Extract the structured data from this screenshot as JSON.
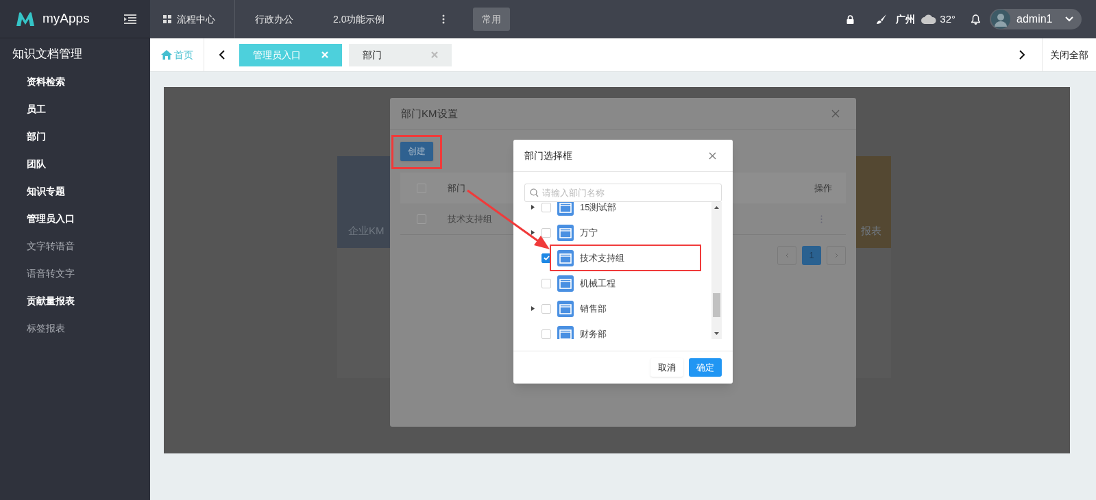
{
  "app": {
    "name": "myApps"
  },
  "top_nav": {
    "items": [
      {
        "label": "流程中心",
        "kind": "grid"
      },
      {
        "label": "行政办公",
        "kind": "plain"
      },
      {
        "label": "2.0功能示例",
        "kind": "plain"
      }
    ],
    "common_button": "常用"
  },
  "status": {
    "city": "广州",
    "temperature": "32°",
    "user": "admin1"
  },
  "sidebar": {
    "title": "知识文档管理",
    "items": [
      {
        "label": "资料检索",
        "highlighted": true
      },
      {
        "label": "员工",
        "highlighted": true
      },
      {
        "label": "部门",
        "highlighted": true
      },
      {
        "label": "团队",
        "highlighted": true
      },
      {
        "label": "知识专题",
        "highlighted": true
      },
      {
        "label": "管理员入口",
        "highlighted": true
      },
      {
        "label": "文字转语音",
        "highlighted": false
      },
      {
        "label": "语音转文字",
        "highlighted": false
      },
      {
        "label": "贡献量报表",
        "highlighted": true
      },
      {
        "label": "标签报表",
        "highlighted": false
      }
    ]
  },
  "tab_bar": {
    "home": "首页",
    "tabs": [
      {
        "label": "管理员入口",
        "selected": true
      },
      {
        "label": "部门",
        "selected": false
      }
    ],
    "close_all": "关闭全部"
  },
  "background_cards": [
    {
      "title": "企业KM",
      "color": "#3f4753"
    },
    {
      "title": "报表",
      "color": "#544832"
    }
  ],
  "settings_dialog": {
    "title": "部门KM设置",
    "create_button": {
      "label": "创建",
      "annotated": true
    },
    "columns": [
      "部门",
      "操作"
    ],
    "header_checked": false,
    "rows": [
      {
        "department": "技术支持组",
        "checked": false
      }
    ],
    "pages": [
      {
        "label": "1",
        "selected": true
      }
    ]
  },
  "picker_dialog": {
    "title": "部门选择框",
    "search": {
      "placeholder": "请输入部门名称"
    },
    "tree": [
      {
        "label": "15测试部",
        "expandable": true,
        "checked": false,
        "annotated": false
      },
      {
        "label": "万宁",
        "expandable": true,
        "checked": false,
        "annotated": false
      },
      {
        "label": "技术支持组",
        "expandable": false,
        "checked": true,
        "annotated": true
      },
      {
        "label": "机械工程",
        "expandable": false,
        "checked": false,
        "annotated": false
      },
      {
        "label": "销售部",
        "expandable": true,
        "checked": false,
        "annotated": false
      },
      {
        "label": "财务部",
        "expandable": false,
        "checked": false,
        "annotated": false
      }
    ],
    "cancel": "取消",
    "ok": "确定"
  }
}
